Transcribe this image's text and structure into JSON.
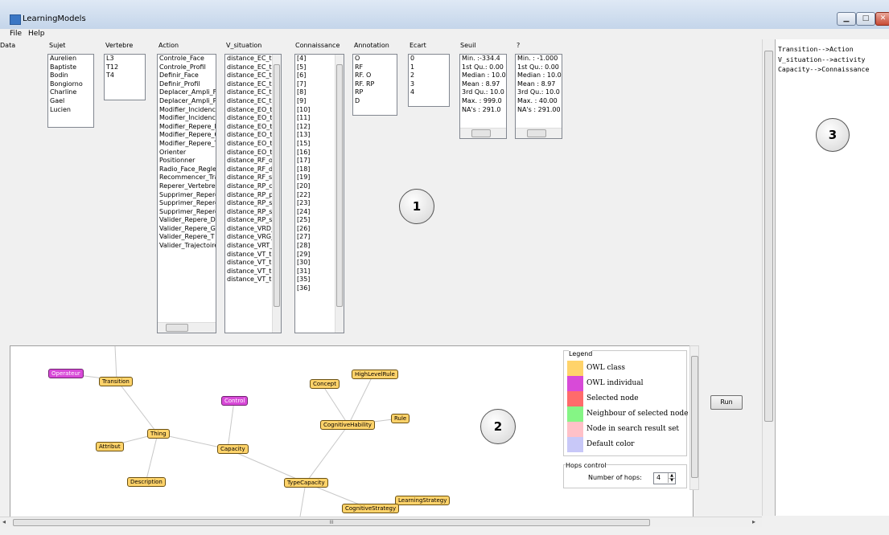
{
  "window": {
    "title": "LearningModels",
    "min": "▁",
    "max": "□",
    "close": "✕"
  },
  "menu": {
    "file": "File",
    "help": "Help"
  },
  "data_label": "Data",
  "columns": {
    "sujet": {
      "header": "Sujet",
      "items": [
        "Aurelien",
        "Baptiste",
        "Bodin",
        "Bongiorno",
        "Charline",
        "Gael",
        "Lucien"
      ]
    },
    "vertebre": {
      "header": "Vertebre",
      "items": [
        "L3",
        "T12",
        "T4"
      ]
    },
    "action": {
      "header": "Action",
      "items": [
        "Controle_Face",
        "Controle_Profil",
        "Definir_Face",
        "Definir_Profil",
        "Deplacer_Ampli_Fa",
        "Deplacer_Ampli_Pr",
        "Modifier_Incidence",
        "Modifier_Incidence",
        "Modifier_Repere_D",
        "Modifier_Repere_G",
        "Modifier_Repere_T",
        "Orienter",
        "Positionner",
        "Radio_Face_Regle",
        "Recommencer_Tra",
        "Reperer_Vertebre",
        "Supprimer_Repere",
        "Supprimer_Repere",
        "Supprimer_Repere",
        "Valider_Repere_D",
        "Valider_Repere_G",
        "Valider_Repere_T",
        "Valider_Trajectoire"
      ]
    },
    "v_situation": {
      "header": "V_situation",
      "items": [
        "distance_EC_tr",
        "distance_EC_tr",
        "distance_EC_tr",
        "distance_EC_tr",
        "distance_EC_tr",
        "distance_EC_tr",
        "distance_EO_tr",
        "distance_EO_tr",
        "distance_EO_tr",
        "distance_EO_tr",
        "distance_EO_tr",
        "distance_EO_tr",
        "distance_RF_oi",
        "distance_RF_di",
        "distance_RF_s\\",
        "distance_RP_c\\",
        "distance_RP_p\\",
        "distance_RP_su",
        "distance_RP_su",
        "distance_RP_si",
        "distance_VRD_",
        "distance_VRG_",
        "distance_VRT_",
        "distance_VT_tr",
        "distance_VT_tr",
        "distance_VT_tr",
        "distance_VT_tr"
      ]
    },
    "connaissance": {
      "header": "Connaissance",
      "items": [
        "[4]",
        "[5]",
        "[6]",
        "[7]",
        "[8]",
        "[9]",
        "[10]",
        "[11]",
        "[12]",
        "[13]",
        "[15]",
        "[16]",
        "[17]",
        "[18]",
        "[19]",
        "[20]",
        "[22]",
        "[23]",
        "[24]",
        "[25]",
        "[26]",
        "[27]",
        "[28]",
        "[29]",
        "[30]",
        "[31]",
        "[35]",
        "[36]"
      ]
    },
    "annotation": {
      "header": "Annotation",
      "items": [
        "O",
        "RF",
        "RF. O",
        "RF. RP",
        "RP",
        "D"
      ]
    },
    "ecart": {
      "header": "Ecart",
      "items": [
        "0",
        "1",
        "2",
        "3",
        "4"
      ]
    },
    "seuil": {
      "header": "Seuil",
      "items": [
        "Min.  :-334.4",
        "1st Qu.: 0.00",
        "Median : 10.0",
        "Mean  : 8.97",
        "3rd Qu.: 10.0",
        "Max.  : 999.0",
        "NA's  : 291.0"
      ]
    },
    "q": {
      "header": "?",
      "items": [
        "Min.  : -1.000",
        "1st Qu.: 0.00",
        "Median : 10.0",
        "Mean  : 8.97",
        "3rd Qu.: 10.0",
        "Max.  : 40.00",
        "NA's  : 291.00"
      ]
    }
  },
  "markers": {
    "one": "1",
    "two": "2",
    "three": "3"
  },
  "graph": {
    "nodes": {
      "operateur": "Operateur",
      "transition": "Transition",
      "control": "Control",
      "thing": "Thing",
      "attribut": "Attribut",
      "capacity": "Capacity",
      "description": "Description",
      "concept": "Concept",
      "highlevelrule": "HighLevelRule",
      "rule": "Rule",
      "cognitivehability": "CognitiveHability",
      "typecapacity": "TypeCapacity",
      "learningstrategy": "LearningStrategy",
      "cognitivestrategy": "CognitiveStrategy"
    }
  },
  "legend": {
    "title": "Legend",
    "items": [
      {
        "label": "OWL class",
        "color": "#ffd36a"
      },
      {
        "label": "OWL individual",
        "color": "#d84ad8"
      },
      {
        "label": "Selected node",
        "color": "#ff6b6b"
      },
      {
        "label": "Neighbour of selected node",
        "color": "#85f585"
      },
      {
        "label": "Node in search result set",
        "color": "#ffc1c8"
      },
      {
        "label": "Default color",
        "color": "#c8c8f8"
      }
    ]
  },
  "hops": {
    "title": "Hops control",
    "label": "Number of hops:",
    "value": "4"
  },
  "run_button": "Run",
  "output_lines": [
    "Transition-->Action",
    "V_situation-->activity",
    "Capacity-->Connaissance"
  ],
  "hscroll_grip": "III"
}
